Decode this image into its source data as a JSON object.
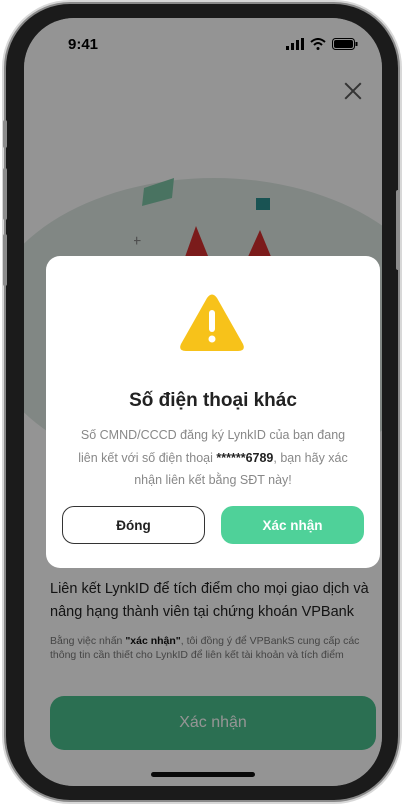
{
  "status_bar": {
    "time": "9:41"
  },
  "background": {
    "description": "Liên kết LynkID để tích điểm cho mọi giao dịch và nâng hạng thành viên tại chứng khoán VPBank",
    "consent_prefix": "Bằng việc nhấn ",
    "consent_emphasis": "\"xác nhận\"",
    "consent_suffix": ", tôi đồng ý để VPBankS cung cấp các thông tin cần thiết cho LynkID để liên kết tài khoản và tích điểm",
    "cta_label": "Xác nhận"
  },
  "dialog": {
    "icon": "warning-triangle-icon",
    "title": "Số điện thoại khác",
    "message_prefix": "Số CMND/CCCD đăng ký LynkID của bạn đang liên kết với số điện thoại ",
    "masked_phone": "******6789",
    "message_suffix": ", bạn hãy xác nhận liên kết bằng SĐT này!",
    "close_label": "Đóng",
    "confirm_label": "Xác nhận"
  },
  "colors": {
    "primary_green": "#4fd199",
    "warning_yellow": "#f7c21a"
  }
}
